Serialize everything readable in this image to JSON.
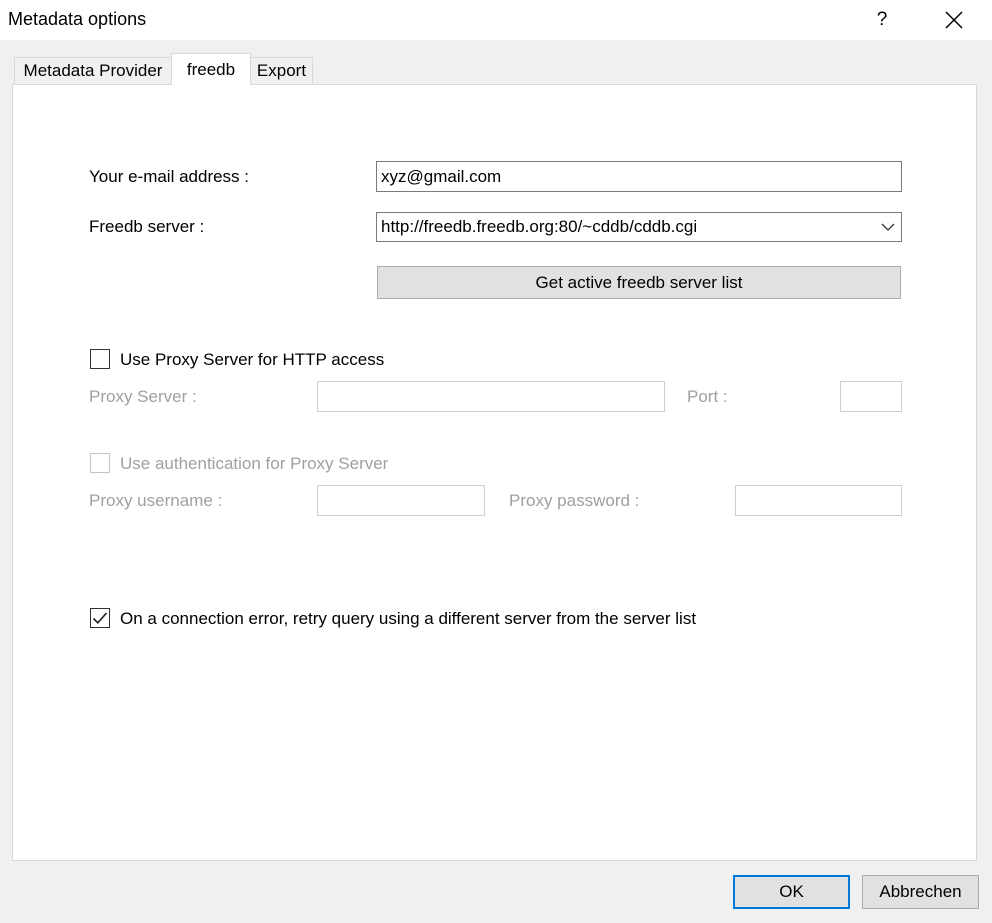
{
  "window": {
    "title": "Metadata options",
    "help_label": "?"
  },
  "tabs": [
    {
      "label": "Metadata Provider"
    },
    {
      "label": "freedb"
    },
    {
      "label": "Export"
    }
  ],
  "form": {
    "email_label": "Your e-mail address :",
    "email_value": "xyz@gmail.com",
    "server_label": "Freedb server :",
    "server_value": "http://freedb.freedb.org:80/~cddb/cddb.cgi",
    "get_list_button": "Get active freedb server list",
    "use_proxy_label": "Use Proxy Server for HTTP access",
    "use_proxy_checked": false,
    "proxy_server_label": "Proxy Server :",
    "proxy_server_value": "",
    "port_label": "Port :",
    "port_value": "",
    "use_auth_label": "Use authentication for Proxy Server",
    "use_auth_checked": false,
    "proxy_username_label": "Proxy username :",
    "proxy_username_value": "",
    "proxy_password_label": "Proxy password :",
    "proxy_password_value": "",
    "retry_label": "On a connection error, retry query using a different server from the server list",
    "retry_checked": true
  },
  "footer": {
    "ok_label": "OK",
    "cancel_label": "Abbrechen"
  },
  "colors": {
    "accent": "#0078d7",
    "disabled_text": "#a0a0a0"
  }
}
